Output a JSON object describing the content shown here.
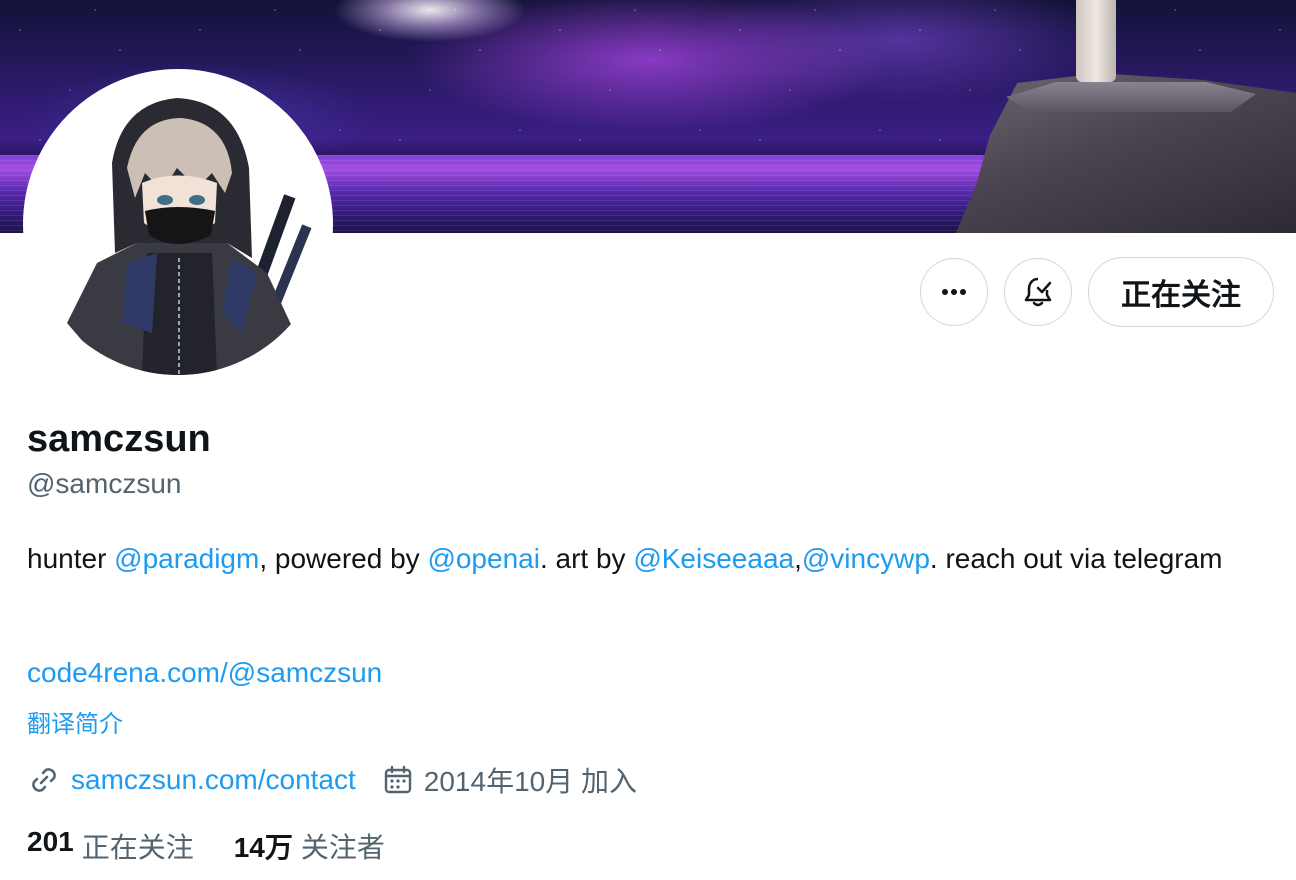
{
  "profile": {
    "display_name": "samczsun",
    "handle": "@samczsun",
    "bio": {
      "t1": "hunter ",
      "m1": "@paradigm",
      "t2": ", powered by ",
      "m2": "@openai",
      "t3": ". art by ",
      "m3": "@Keiseeaaa",
      "t4": ",",
      "m4": "@vincywp",
      "t5": ". reach out via telegram"
    },
    "bio_link": "code4rena.com/@samczsun",
    "translate_label": "翻译简介",
    "website": "samczsun.com/contact",
    "joined": "2014年10月 加入",
    "following_count": "201",
    "following_label": "正在关注",
    "followers_count": "14万",
    "followers_label": "关注者"
  },
  "actions": {
    "more_icon": "more-horizontal-icon",
    "notify_icon": "bell-check-icon",
    "follow_label": "正在关注"
  },
  "icons": {
    "link": "link-icon",
    "calendar": "calendar-icon"
  },
  "colors": {
    "accent": "#1d9bf0",
    "text": "#0f1419",
    "secondary": "#536471",
    "border": "#cfd9de"
  }
}
